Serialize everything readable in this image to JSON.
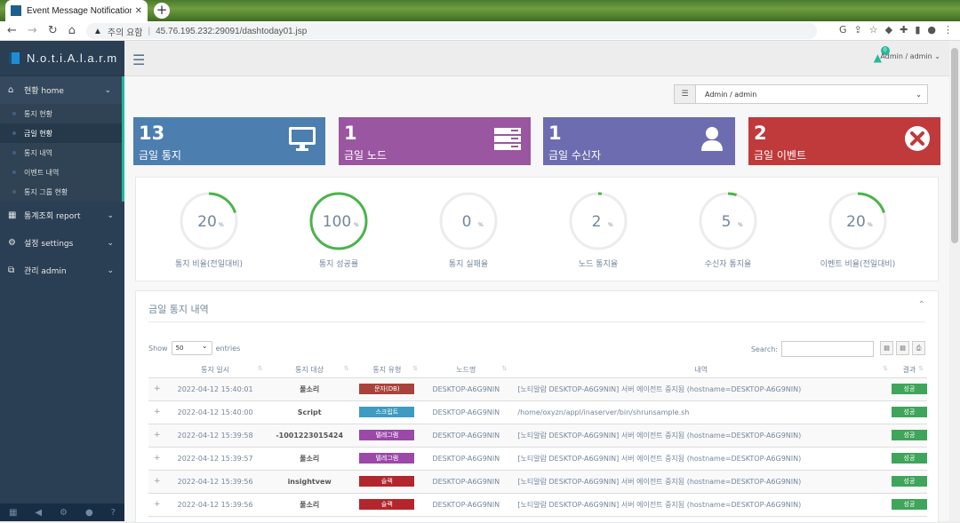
{
  "browser": {
    "tab_title": "Event Message Notification Ma",
    "security_label": "주의 요함",
    "url": "45.76.195.232:29091/dashtoday01.jsp"
  },
  "brand": {
    "name": "N.o.t.i.A.l.a.r.m"
  },
  "sidebar": {
    "items": [
      {
        "label": "현황 home",
        "icon": "home-icon"
      },
      {
        "label": "통계조회 report",
        "icon": "table-icon"
      },
      {
        "label": "설정 settings",
        "icon": "cogs-icon"
      },
      {
        "label": "관리 admin",
        "icon": "sitemap-icon"
      }
    ],
    "sub_items": [
      "통지 현황",
      "금일 현황",
      "통지 내역",
      "이벤트 내역",
      "통지 그룹 현황"
    ]
  },
  "topnav": {
    "alert_count": "0",
    "user": "Admin / admin"
  },
  "selector": {
    "value": "Admin / admin"
  },
  "tiles": [
    {
      "value": "13",
      "label": "금일 통지",
      "color": "#4c7eb0",
      "icon": "monitor-icon"
    },
    {
      "value": "1",
      "label": "금일 노드",
      "color": "#9b56a1",
      "icon": "server-icon"
    },
    {
      "value": "1",
      "label": "금일 수신자",
      "color": "#6e6cb0",
      "icon": "user-icon"
    },
    {
      "value": "2",
      "label": "금일 이벤트",
      "color": "#c0393b",
      "icon": "times-circle-icon"
    }
  ],
  "gauges": [
    {
      "value": "20",
      "unit": "%",
      "label": "통지 비율(전일대비)",
      "percent": 20
    },
    {
      "value": "100",
      "unit": "%",
      "label": "통지 성공률",
      "percent": 100
    },
    {
      "value": "0",
      "unit": "%",
      "label": "통지 실패율",
      "percent": 0
    },
    {
      "value": "2",
      "unit": "%",
      "label": "노드 통지율",
      "percent": 2
    },
    {
      "value": "5",
      "unit": "%",
      "label": "수신자 통지율",
      "percent": 5
    },
    {
      "value": "20",
      "unit": "%",
      "label": "이벤트 비율(전일대비)",
      "percent": 20
    }
  ],
  "table_panel": {
    "title": "금일 통지 내역",
    "show_label": "Show",
    "show_value": "50",
    "entries_label": "entries",
    "search_label": "Search:",
    "columns": [
      "통지 일시",
      "통지 대상",
      "통지 유형",
      "노드명",
      "내역",
      "결과"
    ],
    "rows": [
      {
        "time": "2022-04-12 15:40:01",
        "target": "풀소리",
        "type": "문자(DB)",
        "type_color": "#a8433b",
        "node": "DESKTOP-A6G9NIN",
        "msg": "[노티알람 DESKTOP-A6G9NIN] 서버 에이전트 중지됨 (hostname=DESKTOP-A6G9NIN)",
        "result": "성공"
      },
      {
        "time": "2022-04-12 15:40:00",
        "target": "Script",
        "type": "스크립트",
        "type_color": "#3c9cc1",
        "node": "DESKTOP-A6G9NIN",
        "msg": "/home/oxyzn/appl/inaserver/bin/shrunsample.sh",
        "result": "성공"
      },
      {
        "time": "2022-04-12 15:39:58",
        "target": "-1001223015424",
        "type": "텔레그램",
        "type_color": "#9b48a9",
        "node": "DESKTOP-A6G9NIN",
        "msg": "[노티알람 DESKTOP-A6G9NIN] 서버 에이전트 중지됨 (hostname=DESKTOP-A6G9NIN)",
        "result": "성공"
      },
      {
        "time": "2022-04-12 15:39:57",
        "target": "풀소리",
        "type": "텔레그램",
        "type_color": "#9b48a9",
        "node": "DESKTOP-A6G9NIN",
        "msg": "[노티알람 DESKTOP-A6G9NIN] 서버 에이전트 중지됨 (hostname=DESKTOP-A6G9NIN)",
        "result": "성공"
      },
      {
        "time": "2022-04-12 15:39:56",
        "target": "insightvew",
        "type": "슬랙",
        "type_color": "#b3262c",
        "node": "DESKTOP-A6G9NIN",
        "msg": "[노티알람 DESKTOP-A6G9NIN] 서버 에이전트 중지됨 (hostname=DESKTOP-A6G9NIN)",
        "result": "성공"
      },
      {
        "time": "2022-04-12 15:39:56",
        "target": "풀소리",
        "type": "슬랙",
        "type_color": "#b3262c",
        "node": "DESKTOP-A6G9NIN",
        "msg": "[노티알람 DESKTOP-A6G9NIN] 서버 에이전트 중지됨 (hostname=DESKTOP-A6G9NIN)",
        "result": "성공"
      }
    ]
  }
}
